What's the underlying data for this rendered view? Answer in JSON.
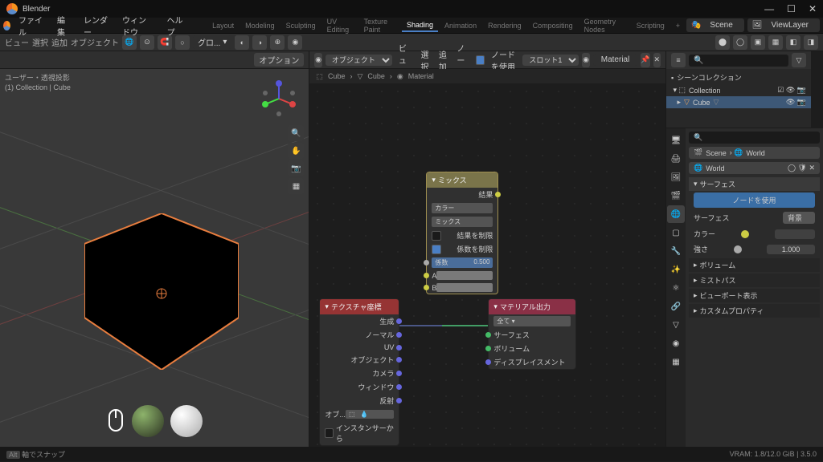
{
  "app_title": "Blender",
  "menus": [
    "ファイル",
    "編集",
    "レンダー",
    "ウィンドウ",
    "ヘルプ"
  ],
  "workspace_tabs": [
    "Layout",
    "Modeling",
    "Sculpting",
    "UV Editing",
    "Texture Paint",
    "Shading",
    "Animation",
    "Rendering",
    "Compositing",
    "Geometry Nodes",
    "Scripting",
    "+"
  ],
  "active_workspace": "Shading",
  "topright": {
    "scene": "Scene",
    "viewlayer": "ViewLayer"
  },
  "toolbar": {
    "modes": [
      "ビュー",
      "選択",
      "追加",
      "オブジェクト"
    ],
    "dropdown": "グロ..."
  },
  "viewport": {
    "options": "オプション",
    "info_top": "ユーザー・透視投影",
    "info_bottom": "(1) Collection | Cube"
  },
  "node_editor": {
    "header": {
      "object": "オブジェクト",
      "view": "ビュー",
      "select": "選択",
      "add": "追加",
      "node": "ノード",
      "use_nodes": "ノードを使用",
      "slot": "スロット1",
      "material": "Material"
    },
    "breadcrumb": [
      "Cube",
      "Cube",
      "Material"
    ],
    "nodes": {
      "mix": {
        "title": "ミックス",
        "result": "結果",
        "color": "カラー",
        "mix": "ミックス",
        "clamp_result": "結果を制限",
        "clamp_factor": "係数を制限",
        "factor_label": "係数",
        "factor_val": "0.500",
        "a": "A",
        "b": "B"
      },
      "texcoord": {
        "title": "テクスチャ座標",
        "gen": "生成",
        "normal": "ノーマル",
        "uv": "UV",
        "object": "オブジェクト",
        "camera": "カメラ",
        "window": "ウィンドウ",
        "reflection": "反射",
        "obj_label": "オブ...",
        "instancer": "インスタンサーから"
      },
      "output": {
        "title": "マテリアル出力",
        "all": "全て",
        "surface": "サーフェス",
        "volume": "ボリューム",
        "displacement": "ディスプレイスメント"
      }
    }
  },
  "outliner": {
    "scene_col": "シーンコレクション",
    "collection": "Collection",
    "cube": "Cube"
  },
  "props": {
    "breadcrumb": [
      "Scene",
      "World"
    ],
    "world": "World",
    "surface_panel": "サーフェス",
    "use_nodes": "ノードを使用",
    "surface": "サーフェス",
    "surface_val": "背景",
    "color": "カラー",
    "strength": "強さ",
    "strength_val": "1.000",
    "volume": "ボリューム",
    "mist": "ミストパス",
    "viewport": "ビューポート表示",
    "custom": "カスタムプロパティ"
  },
  "statusbar": {
    "left": "軸でスナップ",
    "right": "VRAM: 1.8/12.0 GiB | 3.5.0"
  }
}
